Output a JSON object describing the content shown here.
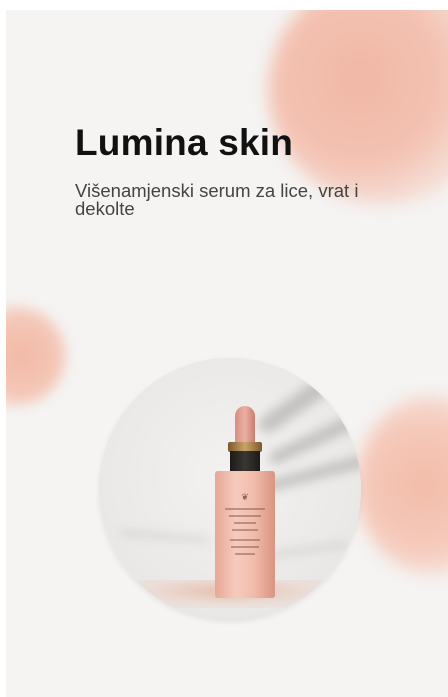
{
  "hero": {
    "title": "Lumina skin",
    "subtitle": "Višenamjenski serum za lice, vrat i dekolte"
  },
  "product": {
    "image_icon": "serum-bottle-icon"
  },
  "colors": {
    "background": "#f5f4f3",
    "accent_peach": "#f2b9a6",
    "title": "#111111",
    "subtitle": "#444444"
  }
}
